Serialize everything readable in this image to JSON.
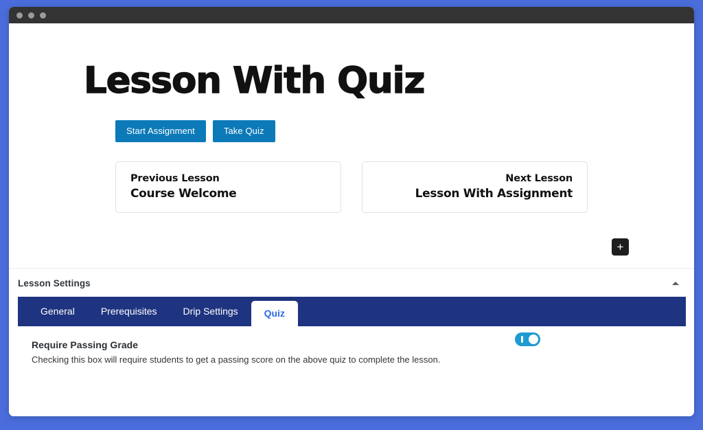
{
  "window": {
    "traffic_lights": [
      "close",
      "minimize",
      "zoom"
    ]
  },
  "lesson": {
    "title": "Lesson With Quiz",
    "actions": [
      {
        "label": "Start Assignment",
        "name": "start-assignment-button"
      },
      {
        "label": "Take Quiz",
        "name": "take-quiz-button"
      }
    ],
    "navigation": {
      "previous": {
        "kicker": "Previous Lesson",
        "name": "Course Welcome"
      },
      "next": {
        "kicker": "Next Lesson",
        "name": "Lesson With Assignment"
      }
    },
    "add_block_label": "+"
  },
  "settings": {
    "panel_title": "Lesson Settings",
    "collapse_icon": "caret-up-icon",
    "tabs": [
      {
        "label": "General",
        "active": false
      },
      {
        "label": "Prerequisites",
        "active": false
      },
      {
        "label": "Drip Settings",
        "active": false
      },
      {
        "label": "Quiz",
        "active": true
      }
    ],
    "quiz_tab": {
      "require_passing_grade": {
        "label": "Require Passing Grade",
        "description": "Checking this box will require students to get a passing score on the above quiz to complete the lesson.",
        "enabled": true
      }
    }
  },
  "colors": {
    "page_background": "#4a6ddb",
    "titlebar": "#333333",
    "button_primary": "#0c7ab8",
    "tabbar": "#1f3480",
    "tab_active_text": "#2e6de0",
    "switch_on": "#1e9bd1",
    "add_block_button": "#1e1e1e"
  }
}
